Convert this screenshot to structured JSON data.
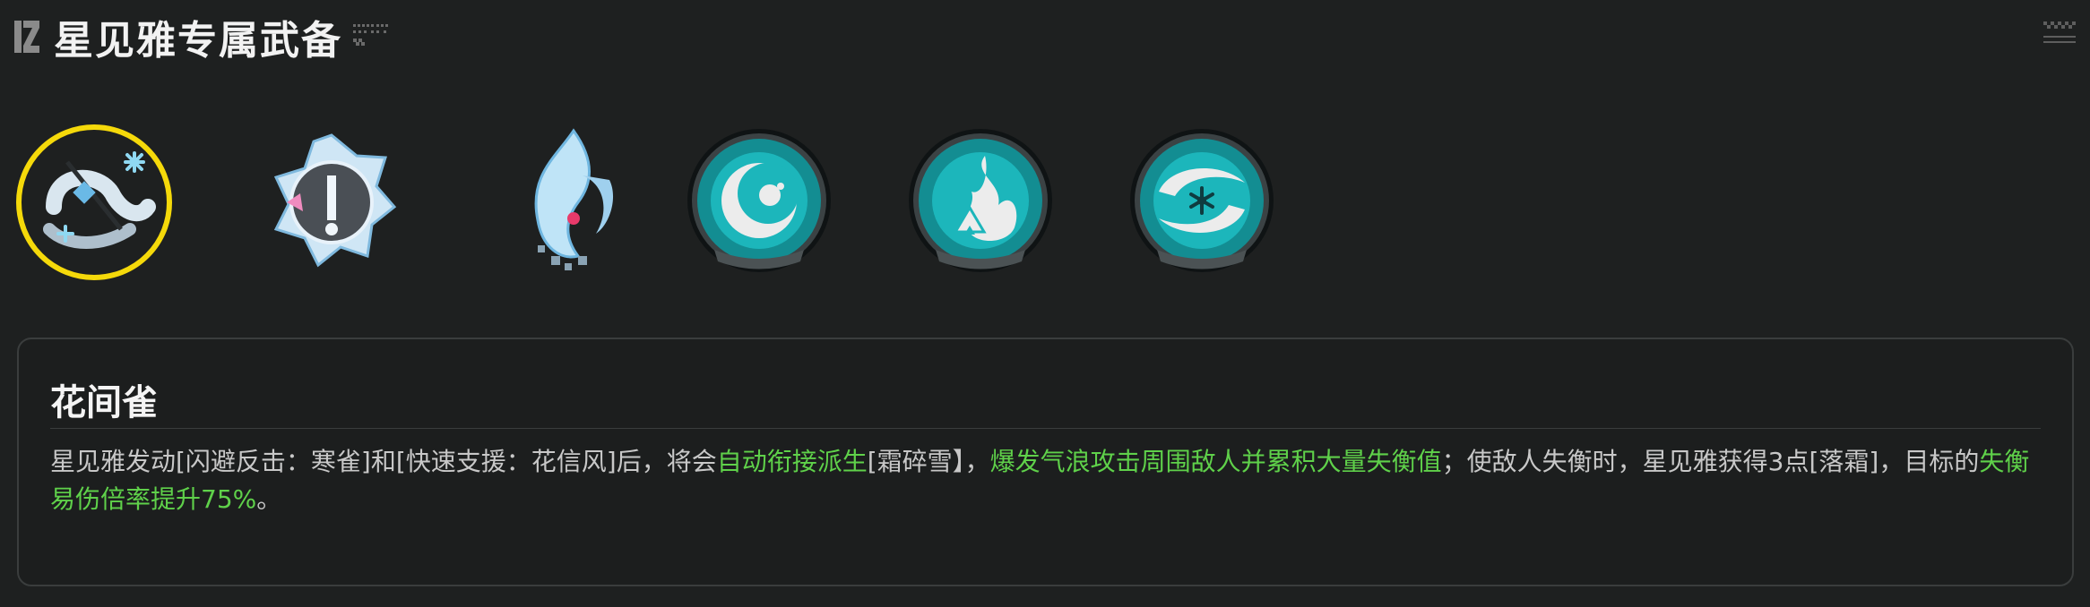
{
  "header": {
    "title": "星见雅专属武备",
    "logo_icon": "zzz-logo-icon",
    "deco_icon": "barcode-deco-icon"
  },
  "corner": {
    "icon": "checker-deco-icon"
  },
  "icons": [
    {
      "name": "skill-icon-hua-jian-que",
      "selected": true,
      "selected_color": "#f5d90a"
    },
    {
      "name": "skill-icon-shield-blade",
      "selected": false
    },
    {
      "name": "skill-icon-frost-blade",
      "selected": false
    },
    {
      "name": "core-passive-icon",
      "selected": false
    },
    {
      "name": "core-skill-icon",
      "selected": false
    },
    {
      "name": "ultimate-icon",
      "selected": false
    }
  ],
  "panel": {
    "title": "花间雀",
    "desc": {
      "p1": "星见雅发动[闪避反击：寒雀]和[快速支援：花信风]后，将会",
      "h1": "自动衔接派生",
      "p2": "[霜碎雪】，",
      "h2": "爆发气浪攻击周围敌人并累积大量失衡值",
      "p3": "；使敌人失衡时，星见雅获得3点[落霜]，目标的",
      "h3": "失衡易伤倍率提升75%",
      "p4": "。"
    }
  },
  "colors": {
    "background": "#1e2020",
    "highlight": "#5fd14a",
    "teal": "#1aa3a8",
    "selected_ring": "#f5d90a"
  }
}
